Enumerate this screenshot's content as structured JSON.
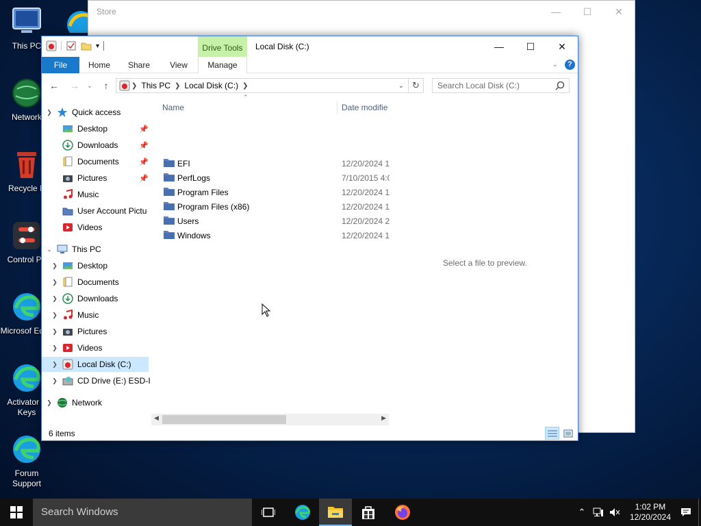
{
  "desktop": {
    "icons": [
      {
        "label": "This PC"
      },
      {
        "label": "Network"
      },
      {
        "label": "Recycle B"
      },
      {
        "label": "Control Pa"
      },
      {
        "label": "Microsof Edge"
      },
      {
        "label": "Activator A Keys"
      },
      {
        "label": "Forum Support"
      }
    ]
  },
  "store_window": {
    "title": "Store"
  },
  "explorer": {
    "title": "Local Disk (C:)",
    "context_tab": "Drive Tools",
    "ribbon_tabs": [
      "File",
      "Home",
      "Share",
      "View",
      "Manage"
    ],
    "address": {
      "segments": [
        "This PC",
        "Local Disk (C:)"
      ]
    },
    "search_placeholder": "Search Local Disk (C:)",
    "sidebar": {
      "quick_access": "Quick access",
      "quick_items": [
        "Desktop",
        "Downloads",
        "Documents",
        "Pictures",
        "Music",
        "User Account Pictu",
        "Videos"
      ],
      "this_pc": "This PC",
      "pc_items": [
        "Desktop",
        "Documents",
        "Downloads",
        "Music",
        "Pictures",
        "Videos",
        "Local Disk (C:)",
        "CD Drive (E:) ESD-IS"
      ],
      "network": "Network"
    },
    "columns": {
      "name": "Name",
      "date": "Date modifie"
    },
    "files": [
      {
        "name": "EFI",
        "date": "12/20/2024 1("
      },
      {
        "name": "PerfLogs",
        "date": "7/10/2015 4:0"
      },
      {
        "name": "Program Files",
        "date": "12/20/2024 1"
      },
      {
        "name": "Program Files (x86)",
        "date": "12/20/2024 1'"
      },
      {
        "name": "Users",
        "date": "12/20/2024 2:"
      },
      {
        "name": "Windows",
        "date": "12/20/2024 1:"
      }
    ],
    "preview_message": "Select a file to preview.",
    "status": "6 items"
  },
  "taskbar": {
    "search_placeholder": "Search Windows",
    "time": "1:02 PM",
    "date": "12/20/2024"
  }
}
